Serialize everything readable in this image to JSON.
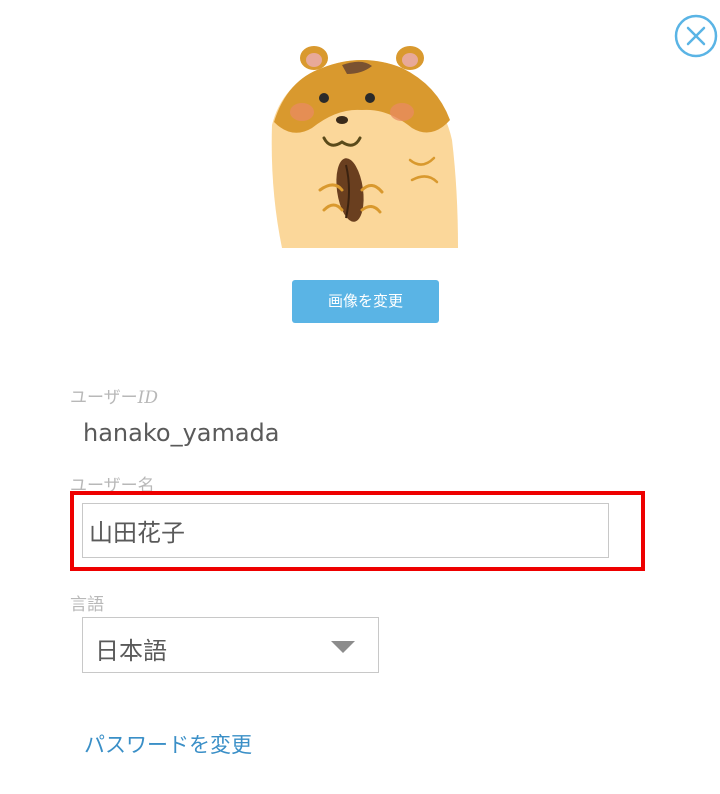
{
  "profile": {
    "avatar_alt": "hamster-avatar",
    "change_image_label": "画像を変更",
    "user_id_label_prefix": "ユーザー",
    "user_id_label_suffix": "ID",
    "user_id_value": "hanako_yamada",
    "user_name_label": "ユーザー名",
    "user_name_value": "山田花子",
    "language_label": "言語",
    "language_selected": "日本語",
    "change_password_label": "パスワードを変更"
  },
  "icons": {
    "close": "close-icon",
    "dropdown": "triangle-down-icon"
  },
  "colors": {
    "accent": "#5ab4e5",
    "link": "#3a8fc7",
    "highlight": "#ee0000",
    "close_icon": "#5ab4e5"
  }
}
